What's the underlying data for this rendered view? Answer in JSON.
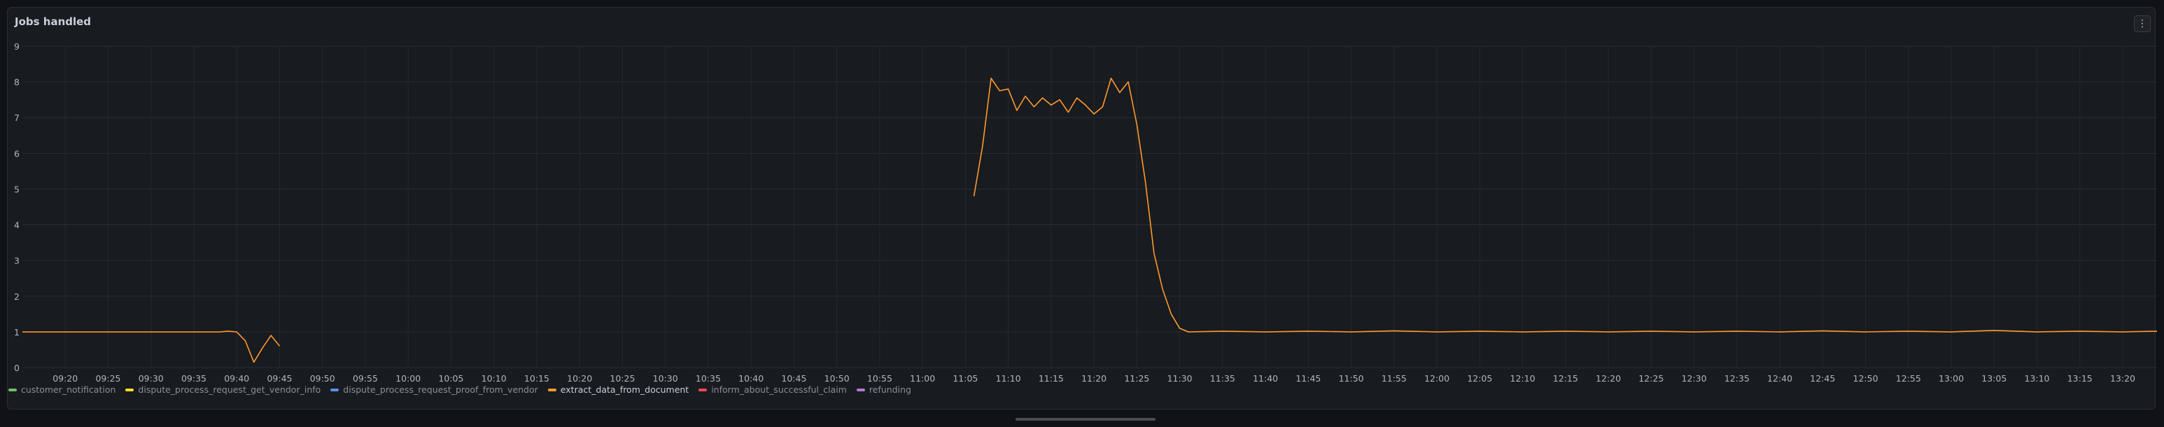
{
  "panel": {
    "title": "Jobs handled",
    "menu_icon": "more-vertical-icon"
  },
  "chart_data": {
    "type": "line",
    "title": "Jobs handled",
    "ylim": [
      0,
      9
    ],
    "yticks": [
      0,
      1,
      2,
      3,
      4,
      5,
      6,
      7,
      8,
      9
    ],
    "xlim": [
      "09:15",
      "13:24"
    ],
    "xticks": [
      "09:20",
      "09:25",
      "09:30",
      "09:35",
      "09:40",
      "09:45",
      "09:50",
      "09:55",
      "10:00",
      "10:05",
      "10:10",
      "10:15",
      "10:20",
      "10:25",
      "10:30",
      "10:35",
      "10:40",
      "10:45",
      "10:50",
      "10:55",
      "11:00",
      "11:05",
      "11:10",
      "11:15",
      "11:20",
      "11:25",
      "11:30",
      "11:35",
      "11:40",
      "11:45",
      "11:50",
      "11:55",
      "12:00",
      "12:05",
      "12:10",
      "12:15",
      "12:20",
      "12:25",
      "12:30",
      "12:35",
      "12:40",
      "12:45",
      "12:50",
      "12:55",
      "13:00",
      "13:05",
      "13:10",
      "13:15",
      "13:20"
    ],
    "grid": true,
    "legend_position": "bottom-left",
    "series": [
      {
        "name": "customer_notification",
        "color": "#73bf69",
        "points": []
      },
      {
        "name": "dispute_process_request_get_vendor_info",
        "color": "#fade2a",
        "points": []
      },
      {
        "name": "dispute_process_request_proof_from_vendor",
        "color": "#5794f2",
        "points": []
      },
      {
        "name": "extract_data_from_document",
        "color": "#ff9830",
        "active": true,
        "segments": [
          [
            [
              "09:15",
              1.0
            ],
            [
              "09:20",
              1.0
            ],
            [
              "09:25",
              1.0
            ],
            [
              "09:30",
              1.0
            ],
            [
              "09:35",
              1.0
            ],
            [
              "09:38",
              1.0
            ],
            [
              "09:39",
              1.02
            ],
            [
              "09:40",
              1.0
            ],
            [
              "09:41",
              0.75
            ],
            [
              "09:42",
              0.15
            ],
            [
              "09:43",
              0.55
            ],
            [
              "09:44",
              0.9
            ],
            [
              "09:45",
              0.6
            ]
          ],
          [
            [
              "11:06",
              4.8
            ],
            [
              "11:07",
              6.2
            ],
            [
              "11:08",
              8.1
            ],
            [
              "11:09",
              7.75
            ],
            [
              "11:10",
              7.8
            ],
            [
              "11:11",
              7.2
            ],
            [
              "11:12",
              7.6
            ],
            [
              "11:13",
              7.3
            ],
            [
              "11:14",
              7.55
            ],
            [
              "11:15",
              7.35
            ],
            [
              "11:16",
              7.5
            ],
            [
              "11:17",
              7.15
            ],
            [
              "11:18",
              7.55
            ],
            [
              "11:19",
              7.35
            ],
            [
              "11:20",
              7.1
            ],
            [
              "11:21",
              7.3
            ],
            [
              "11:22",
              8.1
            ],
            [
              "11:23",
              7.7
            ],
            [
              "11:24",
              8.0
            ],
            [
              "11:25",
              6.8
            ],
            [
              "11:26",
              5.2
            ],
            [
              "11:27",
              3.2
            ],
            [
              "11:28",
              2.2
            ],
            [
              "11:29",
              1.5
            ],
            [
              "11:30",
              1.1
            ],
            [
              "11:31",
              1.0
            ],
            [
              "11:35",
              1.02
            ],
            [
              "11:40",
              1.0
            ],
            [
              "11:45",
              1.02
            ],
            [
              "11:50",
              1.0
            ],
            [
              "11:55",
              1.03
            ],
            [
              "12:00",
              1.0
            ],
            [
              "12:05",
              1.02
            ],
            [
              "12:10",
              1.0
            ],
            [
              "12:15",
              1.02
            ],
            [
              "12:20",
              1.0
            ],
            [
              "12:25",
              1.02
            ],
            [
              "12:30",
              1.0
            ],
            [
              "12:35",
              1.02
            ],
            [
              "12:40",
              1.0
            ],
            [
              "12:45",
              1.03
            ],
            [
              "12:50",
              1.0
            ],
            [
              "12:55",
              1.02
            ],
            [
              "13:00",
              1.0
            ],
            [
              "13:05",
              1.04
            ],
            [
              "13:10",
              1.0
            ],
            [
              "13:15",
              1.02
            ],
            [
              "13:20",
              1.0
            ],
            [
              "13:24",
              1.02
            ]
          ]
        ]
      },
      {
        "name": "inform_about_successful_claim",
        "color": "#f2495c",
        "points": []
      },
      {
        "name": "refunding",
        "color": "#b877d9",
        "points": []
      }
    ]
  }
}
